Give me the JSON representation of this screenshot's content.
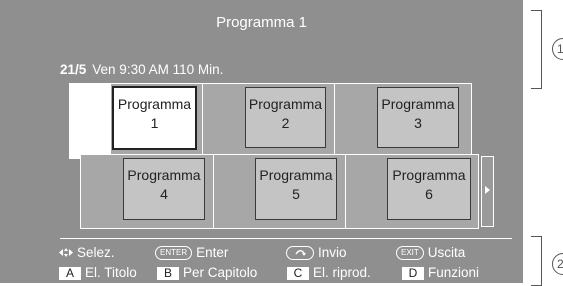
{
  "header": {
    "title": "Programma 1"
  },
  "info": {
    "date": "21/5",
    "details": "Ven 9:30 AM 110 Min."
  },
  "thumbnails": [
    {
      "label": "Programma",
      "number": "1",
      "selected": true
    },
    {
      "label": "Programma",
      "number": "2",
      "selected": false
    },
    {
      "label": "Programma",
      "number": "3",
      "selected": false
    },
    {
      "label": "Programma",
      "number": "4",
      "selected": false
    },
    {
      "label": "Programma",
      "number": "5",
      "selected": false
    },
    {
      "label": "Programma",
      "number": "6",
      "selected": false
    }
  ],
  "legend": {
    "select": "Selez.",
    "enter_key": "ENTER",
    "enter": "Enter",
    "return": "Invio",
    "exit_key": "EXIT",
    "exit": "Uscita",
    "a_key": "A",
    "a_label": "El. Titolo",
    "b_key": "B",
    "b_label": "Per Capitolo",
    "c_key": "C",
    "c_label": "El. riprod.",
    "d_key": "D",
    "d_label": "Funzioni"
  },
  "callouts": [
    "1",
    "2"
  ],
  "colors": {
    "screen_bg": "#8f8f8f",
    "row_bg": "#a7a7a7",
    "thumb_bg": "#c4c4c4",
    "text": "#ffffff"
  }
}
